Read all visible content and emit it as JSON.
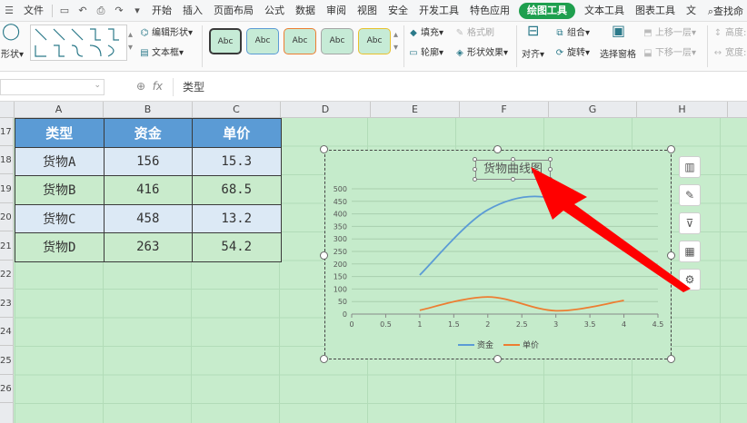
{
  "menubar": {
    "file": "文件",
    "items": [
      "开始",
      "插入",
      "页面布局",
      "公式",
      "数据",
      "审阅",
      "视图",
      "安全",
      "开发工具",
      "特色应用"
    ],
    "active": "绘图工具",
    "items_after": [
      "文本工具",
      "图表工具",
      "文"
    ],
    "search": "查找命"
  },
  "ribbon": {
    "shape_label": "形状",
    "edit_shape": "编辑形状",
    "text_box": "文本框",
    "style_sample": "Abc",
    "fill": "填充",
    "format_painter": "格式刷",
    "outline": "轮廓",
    "shape_effect": "形状效果",
    "align": "对齐",
    "group": "组合",
    "rotate": "旋转",
    "selection_pane": "选择窗格",
    "bring_forward": "上移一层",
    "send_backward": "下移一层",
    "height": "高度:",
    "width": "宽度:"
  },
  "formula_bar": {
    "fx": "fx",
    "content": "类型"
  },
  "columns": [
    "A",
    "B",
    "C",
    "D",
    "E",
    "F",
    "G",
    "H"
  ],
  "rows": [
    "17",
    "18",
    "19",
    "20",
    "21",
    "22",
    "23",
    "24",
    "25",
    "26"
  ],
  "table": {
    "headers": [
      "类型",
      "资金",
      "单价"
    ],
    "rows": [
      [
        "货物A",
        "156",
        "15.3"
      ],
      [
        "货物B",
        "416",
        "68.5"
      ],
      [
        "货物C",
        "458",
        "13.2"
      ],
      [
        "货物D",
        "263",
        "54.2"
      ]
    ]
  },
  "colors": {
    "accent": "#1e9f4e",
    "header_fill": "#5b9bd5",
    "series_funds": "#5b9bd5",
    "series_price": "#ed7d31",
    "arrow": "#ff0000"
  },
  "chart_data": {
    "type": "scatter",
    "title": "货物曲线图",
    "smooth": true,
    "series": [
      {
        "name": "资金",
        "x": [
          1,
          2,
          3,
          4
        ],
        "y": [
          156,
          416,
          458,
          263
        ],
        "color": "#5b9bd5"
      },
      {
        "name": "单价",
        "x": [
          1,
          2,
          3,
          4
        ],
        "y": [
          15.3,
          68.5,
          13.2,
          54.2
        ],
        "color": "#ed7d31"
      }
    ],
    "xlim": [
      0,
      4.5
    ],
    "ylim": [
      0,
      500
    ],
    "xticks": [
      "0",
      "0.5",
      "1",
      "1.5",
      "2",
      "2.5",
      "3",
      "3.5",
      "4",
      "4.5"
    ],
    "yticks": [
      "0",
      "50",
      "100",
      "150",
      "200",
      "250",
      "300",
      "350",
      "400",
      "450",
      "500"
    ],
    "grid": true,
    "legend": "bottom"
  },
  "side_tools": [
    "chart-elements-icon",
    "chart-style-icon",
    "filter-icon",
    "chart-type-icon",
    "settings-icon"
  ]
}
